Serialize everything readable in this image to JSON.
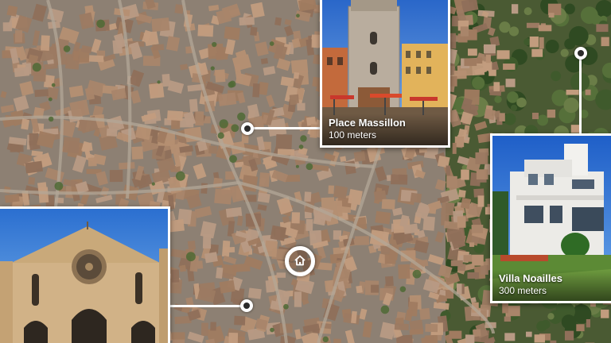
{
  "map": {
    "view": "aerial-satellite",
    "home_marker_icon": "home-icon"
  },
  "places": [
    {
      "title": "Place Massillon",
      "distance": "100 meters",
      "photo": "stone round tower with cafe terrace"
    },
    {
      "title": "Villa Noailles",
      "distance": "300 meters",
      "photo": "white modernist villa with lawn"
    },
    {
      "title": "",
      "distance": "",
      "photo": "romanesque church facade with rose window"
    }
  ],
  "colors": {
    "connector": "#ffffff",
    "pin_center": "#2b2b2b",
    "sky": "#3b7fd6"
  }
}
